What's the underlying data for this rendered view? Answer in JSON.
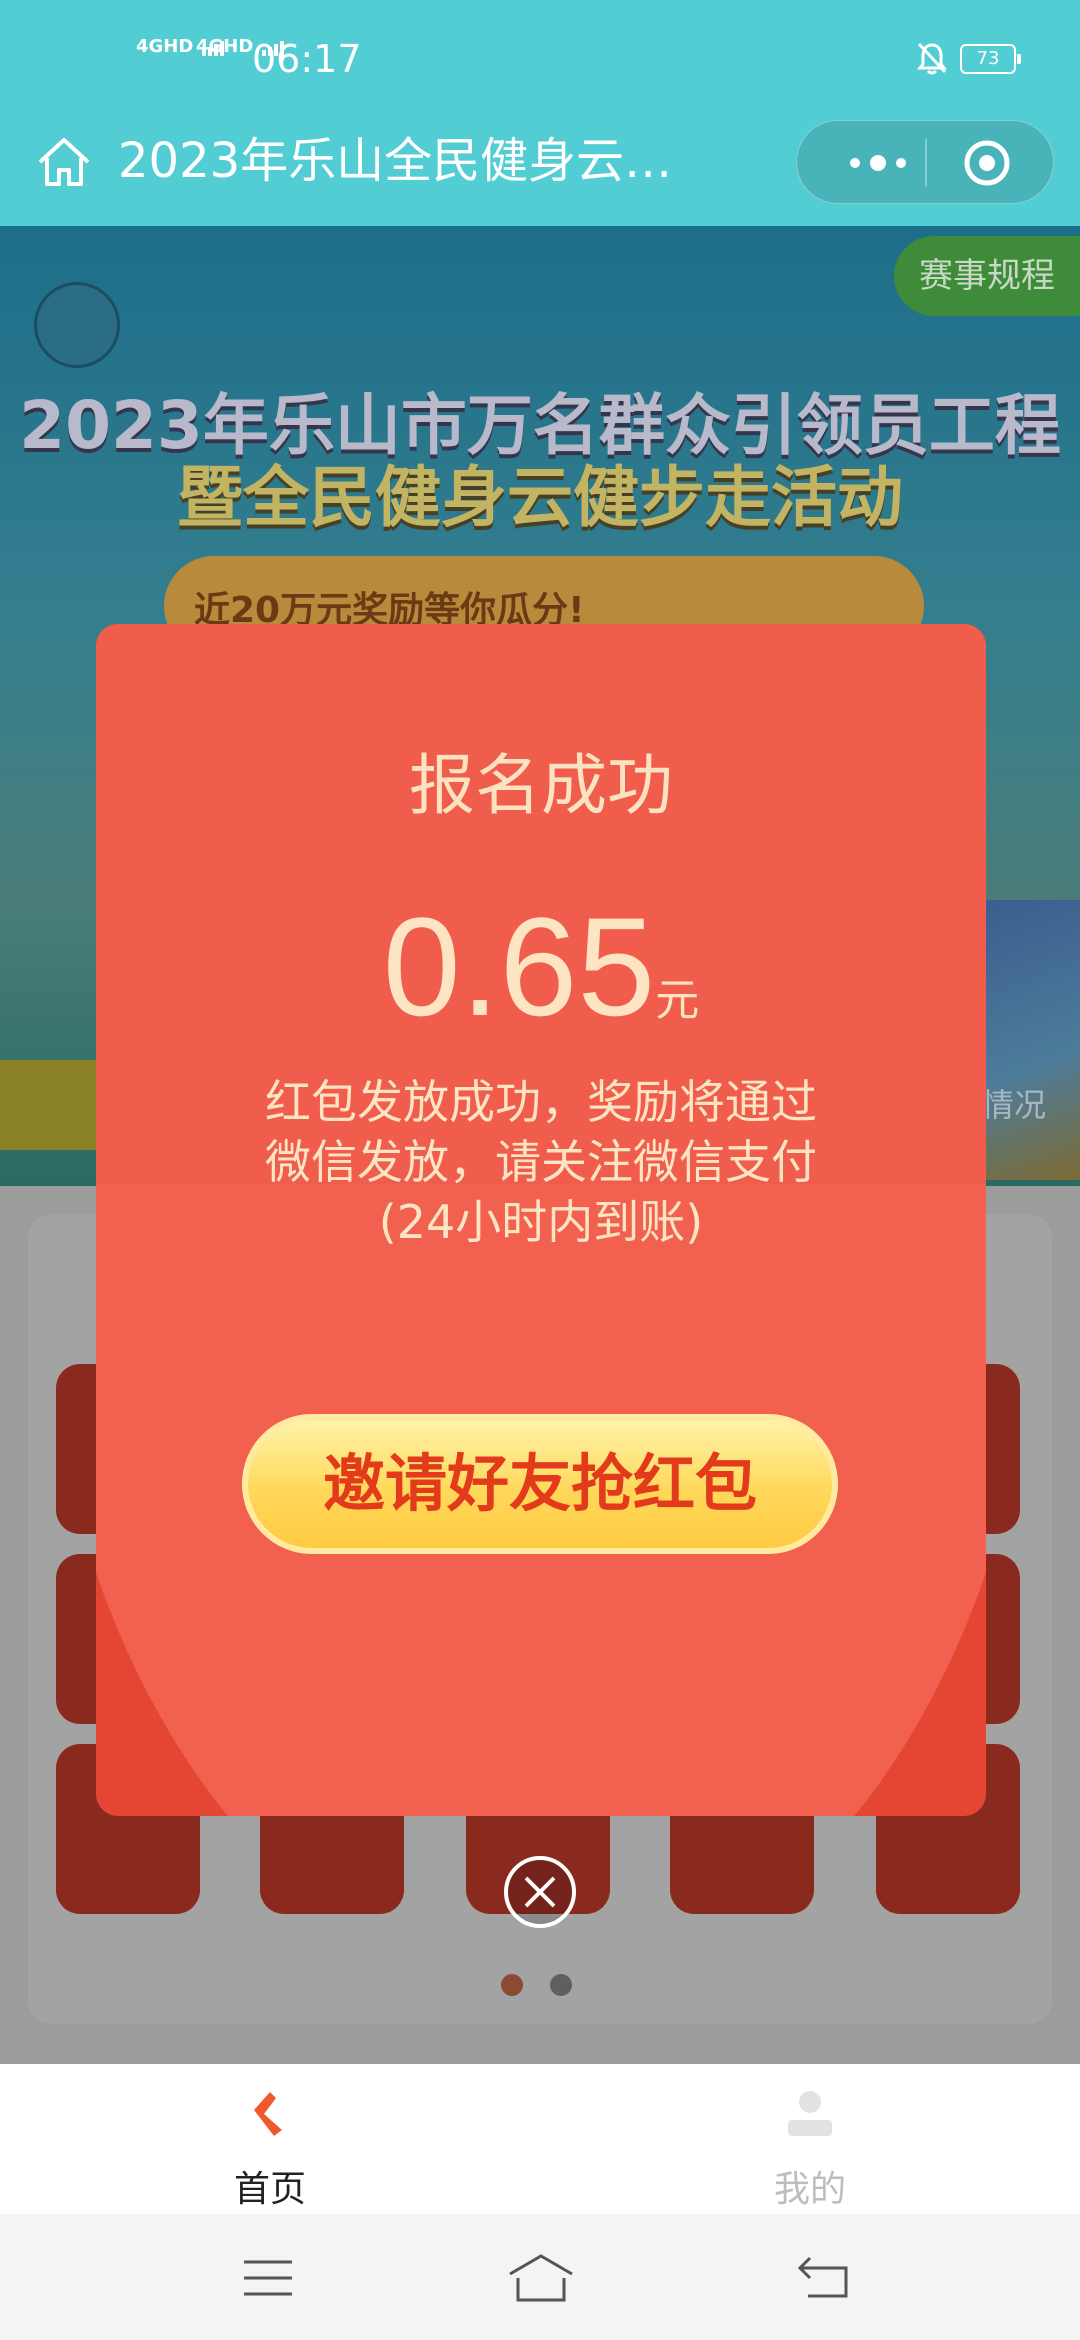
{
  "status_bar": {
    "network1": "4GHD",
    "network2": "4GHD",
    "time": "06:17",
    "battery": "73"
  },
  "title_bar": {
    "title": "2023年乐山全民健身云…"
  },
  "banner": {
    "rules_button": "赛事规程",
    "headline_line1": "2023年乐山市万名群众引领员工程",
    "headline_line2": "暨全民健身云健步走活动",
    "prize_banner": "近20万元奖励等你瓜分!",
    "status_label": "情况"
  },
  "dialog": {
    "title": "报名成功",
    "amount": "0.65",
    "unit": "元",
    "line1": "红包发放成功，奖励将通过",
    "line2": "微信发放，请关注微信支付",
    "line3": "(24小时内到账)",
    "invite_button": "邀请好友抢红包"
  },
  "pager": {
    "active_index": 0,
    "count": 2
  },
  "tabs": [
    {
      "label": "首页",
      "active": true,
      "icon": "shoe-icon"
    },
    {
      "label": "我的",
      "active": false,
      "icon": "user-icon"
    }
  ],
  "colors": {
    "header": "#53cdd4",
    "dialog_red": "#e54633",
    "dialog_text": "#fde4c3",
    "button_yellow": "#ffd85a",
    "active_tab": "#f1582c"
  }
}
